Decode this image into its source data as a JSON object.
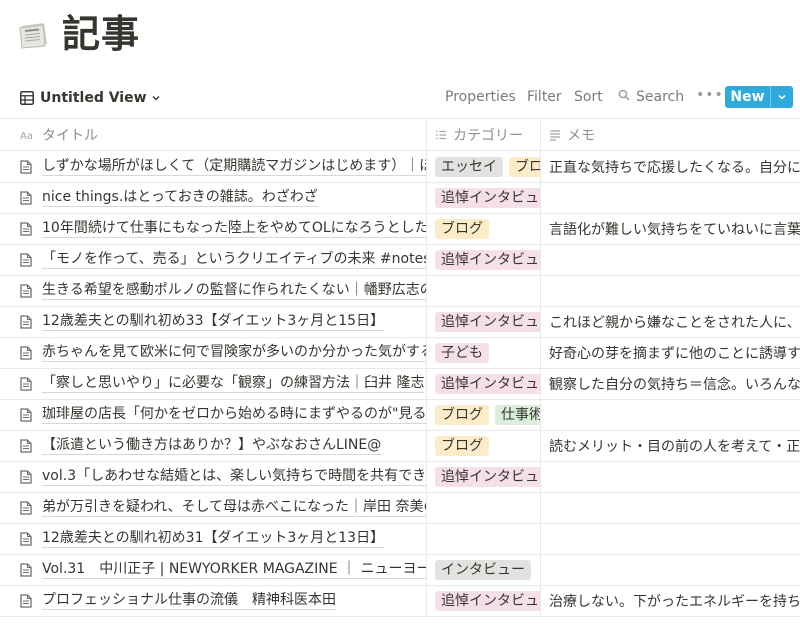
{
  "page": {
    "title": "記事",
    "icon": "newspaper-icon"
  },
  "toolbar": {
    "view_label": "Untitled View",
    "properties": "Properties",
    "filter": "Filter",
    "sort": "Sort",
    "search": "Search",
    "more": "•••",
    "new": "New"
  },
  "table": {
    "columns": [
      {
        "label": "タイトル",
        "icon": "text-property-icon"
      },
      {
        "label": "カテゴリー",
        "icon": "list-property-icon"
      },
      {
        "label": "メモ",
        "icon": "text-lines-icon"
      }
    ],
    "rows": [
      {
        "title": "しずかな場所がほしくて（定期購読マガジンはじめます）｜ほ",
        "tags": [
          "エッセイ",
          "ブロ"
        ],
        "memo": "正直な気持ちで応援したくなる。自分に私"
      },
      {
        "title": "nice things.はとっておきの雑誌。わざわざ",
        "tags": [
          "追悼インタビュー"
        ],
        "memo": ""
      },
      {
        "title": "10年間続けて仕事にもなった陸上をやめてOLになろうとした",
        "tags": [
          "ブログ"
        ],
        "memo": "言語化が難しい気持ちをていねいに言葉"
      },
      {
        "title": "「モノを作って、売る」というクリエイティブの未来 #notes",
        "tags": [
          "追悼インタビュー"
        ],
        "memo": ""
      },
      {
        "title": "生きる希望を感動ポルノの監督に作られたくない｜幡野広志の",
        "tags": [],
        "memo": ""
      },
      {
        "title": "12歳差夫との馴れ初め33【ダイエット3ヶ月と15日】",
        "tags": [
          "追悼インタビュー"
        ],
        "memo": "これほど親から嫌なことをされた人に、"
      },
      {
        "title": "赤ちゃんを見て欧米に何で冒険家が多いのか分かった気がする",
        "tags": [
          "子ども"
        ],
        "memo": "好奇心の芽を摘まずに他のことに誘導す"
      },
      {
        "title": "「察しと思いやり」に必要な「観察」の練習方法｜臼井 隆志",
        "tags": [
          "追悼インタビュー"
        ],
        "memo": "観察した自分の気持ち＝信念。いろんな"
      },
      {
        "title": "珈琲屋の店長「何かをゼロから始める時にまずやるのが\"見る",
        "tags": [
          "ブログ",
          "仕事術"
        ],
        "memo": ""
      },
      {
        "title": "【派遣という働き方はありか？】やぶなおさんLINE@",
        "tags": [
          "ブログ"
        ],
        "memo": "読むメリット・目の前の人を考えて・正"
      },
      {
        "title": "vol.3「しあわせな結婚とは、楽しい気持ちで時間を共有でき",
        "tags": [
          "追悼インタビュー"
        ],
        "memo": ""
      },
      {
        "title": "弟が万引きを疑われ、そして母は赤べこになった｜岸田 奈美の",
        "tags": [],
        "memo": ""
      },
      {
        "title": "12歳差夫との馴れ初め31【ダイエット3ヶ月と13日】",
        "tags": [],
        "memo": ""
      },
      {
        "title": "Vol.31　中川正子 | NEWYORKER MAGAZINE ｜ ニューヨーカー",
        "tags": [
          "インタビュー"
        ],
        "memo": ""
      },
      {
        "title": "プロフェッショナル仕事の流儀　精神科医本田",
        "tags": [
          "追悼インタビュー"
        ],
        "memo": "治療しない。下がったエネルギーを持ち"
      }
    ]
  },
  "tag_colors": {
    "エッセイ": "#e3e2e0",
    "ブロ": "#fdecc8",
    "ブログ": "#fdecc8",
    "追悼インタビュー": "#f5e0e9",
    "子ども": "#f5e0e9",
    "仕事術": "#dbeddb",
    "インタビュー": "#e3e2e0"
  }
}
